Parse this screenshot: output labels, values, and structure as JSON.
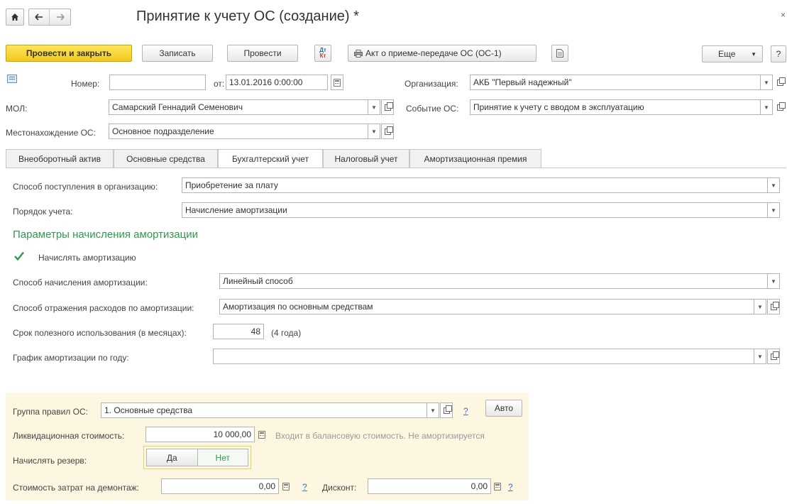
{
  "window": {
    "title": "Принятие к учету ОС (создание) *"
  },
  "nav": {
    "home_icon": "home-icon",
    "back_icon": "arrow-left-icon",
    "forward_icon": "arrow-right-icon"
  },
  "toolbar": {
    "post_close": "Провести и закрыть",
    "save": "Записать",
    "post": "Провести",
    "dtkt_top": "Дт",
    "dtkt_bottom": "Кт",
    "act": "Акт о приеме-передаче ОС (ОС-1)",
    "more": "Еще",
    "help": "?"
  },
  "header": {
    "number_label": "Номер:",
    "number_value": "",
    "date_label": "от:",
    "date_value": "13.01.2016  0:00:00",
    "org_label": "Организация:",
    "org_value": "АКБ \"Первый надежный\"",
    "mol_label": "МОЛ:",
    "mol_value": "Самарский Геннадий Семенович",
    "event_label": "Событие ОС:",
    "event_value": "Принятие к учету с вводом в эксплуатацию",
    "location_label": "Местонахождение ОС:",
    "location_value": "Основное подразделение"
  },
  "tabs": [
    {
      "label": "Внеоборотный актив"
    },
    {
      "label": "Основные средства"
    },
    {
      "label": "Бухгалтерский учет"
    },
    {
      "label": "Налоговый учет"
    },
    {
      "label": "Амортизационная премия"
    }
  ],
  "accounting": {
    "receipt_label": "Способ поступления в организацию:",
    "receipt_value": "Приобретение за плату",
    "order_label": "Порядок учета:",
    "order_value": "Начисление амортизации",
    "section_title": "Параметры начисления амортизации",
    "accrue_label": "Начислять амортизацию",
    "accrue_checked": true,
    "method_label": "Способ начисления амортизации:",
    "method_value": "Линейный способ",
    "expense_label": "Способ отражения расходов по амортизации:",
    "expense_value": "Амортизация по основным средствам",
    "life_label": "Срок полезного использования (в месяцах):",
    "life_value": "48",
    "life_note": "(4 года)",
    "schedule_label": "График амортизации по году:",
    "schedule_value": ""
  },
  "rules": {
    "group_label": "Группа правил ОС:",
    "group_value": "1. Основные средства",
    "help": "?",
    "auto": "Авто",
    "liq_label": "Ликвидационная стоимость:",
    "liq_value": "10 000,00",
    "liq_note": "Входит в балансовую стоимость. Не амортизируется",
    "reserve_label": "Начислять резерв:",
    "reserve_yes": "Да",
    "reserve_no": "Нет",
    "dismantle_label": "Стоимость затрат на демонтаж:",
    "dismantle_value": "0,00",
    "dismantle_help": "?",
    "discount_label": "Дисконт:",
    "discount_value": "0,00",
    "discount_help": "?"
  },
  "colors": {
    "accent_green": "#2e9a4c",
    "yellow_button": "#f5d327",
    "rules_bg": "#fdf7e1",
    "link": "#3a6fc4"
  }
}
